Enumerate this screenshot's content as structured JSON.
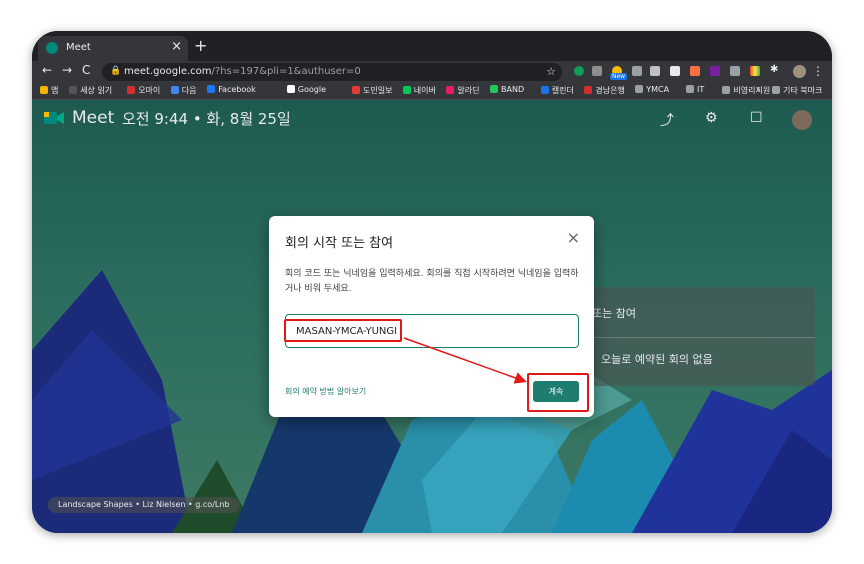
{
  "browser": {
    "tab_title": "Meet",
    "tab_close": "×",
    "new_tab": "+",
    "url_host": "meet.google.com",
    "url_rest": "/?hs=197&pli=1&authuser=0",
    "new_badge": "New",
    "nav": {
      "back": "←",
      "forward": "→",
      "reload": "C",
      "star": "☆",
      "menu": "⋮"
    }
  },
  "bookmarks": [
    {
      "label": "앱",
      "color": "#f4b400"
    },
    {
      "label": "세상 읽기",
      "color": "#555555"
    },
    {
      "label": "오마이",
      "color": "#d32f2f"
    },
    {
      "label": "다음",
      "color": "#4285f4"
    },
    {
      "label": "Facebook",
      "color": "#1877f2"
    },
    {
      "label": "Google",
      "color": "#ffffff"
    },
    {
      "label": "도민일보",
      "color": "#e53935"
    },
    {
      "label": "네이버",
      "color": "#03c75a"
    },
    {
      "label": "알라딘",
      "color": "#e91e63"
    },
    {
      "label": "BAND",
      "color": "#22c55e"
    },
    {
      "label": "캘린더",
      "color": "#1a73e8"
    },
    {
      "label": "경남은행",
      "color": "#d32f2f"
    },
    {
      "label": "YMCA",
      "color": "#9aa0a6"
    },
    {
      "label": "IT",
      "color": "#9aa0a6"
    },
    {
      "label": "비영리지원",
      "color": "#9aa0a6"
    },
    {
      "label": "»",
      "color": ""
    },
    {
      "label": "기타 북마크",
      "color": "#9aa0a6"
    }
  ],
  "meet": {
    "title": "Meet",
    "datetime": "오전 9:44 • 화, 8월 25일",
    "side_card_title": "또는 참여",
    "side_card_empty": "오늘로 예약된 회의 없음",
    "attribution": "Landscape Shapes • Liz Nielsen • g.co/Lnb"
  },
  "dialog": {
    "title": "회의 시작 또는 참여",
    "close": "×",
    "description": "회의 코드 또는 닉네임을 입력하세요. 회의를 직접 시작하려면 닉네임을 입력하거나 비워 두세요.",
    "input_value": "MASAN-YMCA-YUNGI",
    "how_to_link": "회의 예약 방법 알아보기",
    "continue_label": "계속"
  }
}
